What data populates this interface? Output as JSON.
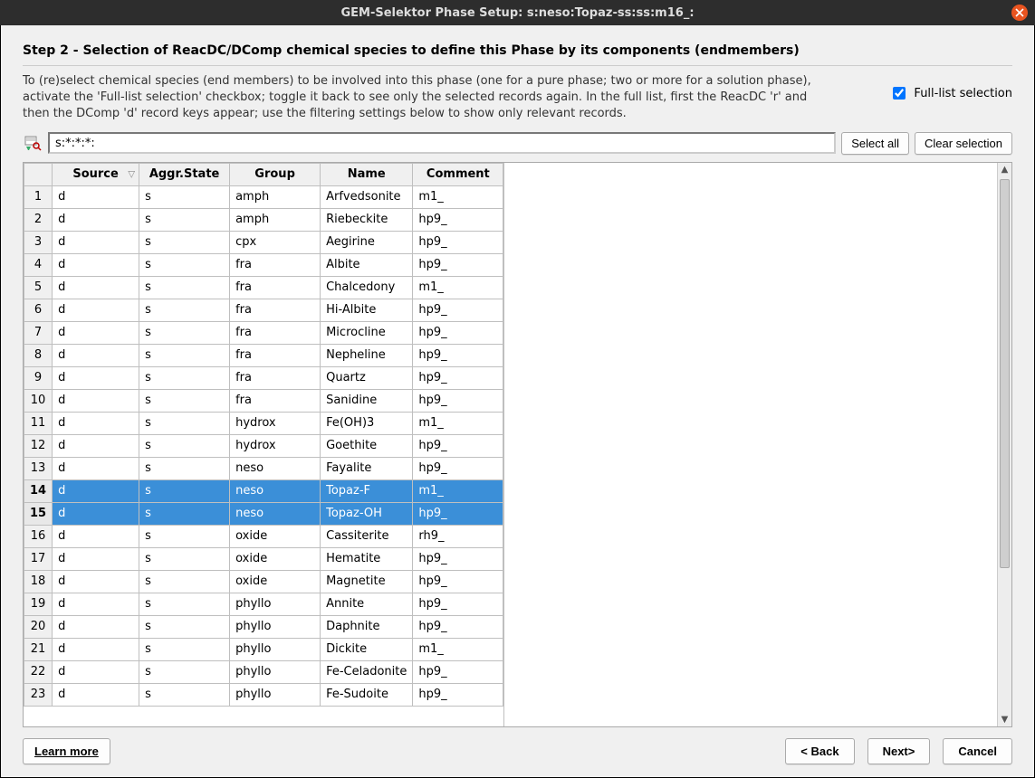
{
  "title": "GEM-Selektor Phase Setup:  s:neso:Topaz-ss:ss:m16_:",
  "step_title": "Step 2 - Selection of ReacDC/DComp chemical species to define this Phase by its components (endmembers)",
  "instructions_l1": "To (re)select chemical species (end members) to be involved into this phase (one for a pure phase; two or more for a solution phase),",
  "instructions_l2": "activate the 'Full-list selection' checkbox; toggle it back to see only the selected records again. In the full list, first the ReacDC 'r' and",
  "instructions_l3": "then the DComp 'd' record keys appear; use the filtering settings below to show only relevant records.",
  "full_list_label": "Full-list selection",
  "full_list_checked": true,
  "filter_value": "s:*:*:*:",
  "select_all_label": "Select all",
  "clear_selection_label": "Clear selection",
  "columns": {
    "source": "Source",
    "aggr": "Aggr.State",
    "group": "Group",
    "name": "Name",
    "comment": "Comment"
  },
  "rows": [
    {
      "n": "1",
      "source": "d",
      "aggr": "s",
      "group": "amph",
      "name": "Arfvedsonite",
      "comment": "m1_",
      "selected": false
    },
    {
      "n": "2",
      "source": "d",
      "aggr": "s",
      "group": "amph",
      "name": "Riebeckite",
      "comment": "hp9_",
      "selected": false
    },
    {
      "n": "3",
      "source": "d",
      "aggr": "s",
      "group": "cpx",
      "name": "Aegirine",
      "comment": "hp9_",
      "selected": false
    },
    {
      "n": "4",
      "source": "d",
      "aggr": "s",
      "group": "fra",
      "name": "Albite",
      "comment": "hp9_",
      "selected": false
    },
    {
      "n": "5",
      "source": "d",
      "aggr": "s",
      "group": "fra",
      "name": "Chalcedony",
      "comment": "m1_",
      "selected": false
    },
    {
      "n": "6",
      "source": "d",
      "aggr": "s",
      "group": "fra",
      "name": "Hi-Albite",
      "comment": "hp9_",
      "selected": false
    },
    {
      "n": "7",
      "source": "d",
      "aggr": "s",
      "group": "fra",
      "name": "Microcline",
      "comment": "hp9_",
      "selected": false
    },
    {
      "n": "8",
      "source": "d",
      "aggr": "s",
      "group": "fra",
      "name": "Nepheline",
      "comment": "hp9_",
      "selected": false
    },
    {
      "n": "9",
      "source": "d",
      "aggr": "s",
      "group": "fra",
      "name": "Quartz",
      "comment": "hp9_",
      "selected": false
    },
    {
      "n": "10",
      "source": "d",
      "aggr": "s",
      "group": "fra",
      "name": "Sanidine",
      "comment": "hp9_",
      "selected": false
    },
    {
      "n": "11",
      "source": "d",
      "aggr": "s",
      "group": "hydrox",
      "name": "Fe(OH)3",
      "comment": "m1_",
      "selected": false
    },
    {
      "n": "12",
      "source": "d",
      "aggr": "s",
      "group": "hydrox",
      "name": "Goethite",
      "comment": "hp9_",
      "selected": false
    },
    {
      "n": "13",
      "source": "d",
      "aggr": "s",
      "group": "neso",
      "name": "Fayalite",
      "comment": "hp9_",
      "selected": false
    },
    {
      "n": "14",
      "source": "d",
      "aggr": "s",
      "group": "neso",
      "name": "Topaz-F",
      "comment": "m1_",
      "selected": true
    },
    {
      "n": "15",
      "source": "d",
      "aggr": "s",
      "group": "neso",
      "name": "Topaz-OH",
      "comment": "hp9_",
      "selected": true
    },
    {
      "n": "16",
      "source": "d",
      "aggr": "s",
      "group": "oxide",
      "name": "Cassiterite",
      "comment": "rh9_",
      "selected": false
    },
    {
      "n": "17",
      "source": "d",
      "aggr": "s",
      "group": "oxide",
      "name": "Hematite",
      "comment": "hp9_",
      "selected": false
    },
    {
      "n": "18",
      "source": "d",
      "aggr": "s",
      "group": "oxide",
      "name": "Magnetite",
      "comment": "hp9_",
      "selected": false
    },
    {
      "n": "19",
      "source": "d",
      "aggr": "s",
      "group": "phyllo",
      "name": "Annite",
      "comment": "hp9_",
      "selected": false
    },
    {
      "n": "20",
      "source": "d",
      "aggr": "s",
      "group": "phyllo",
      "name": "Daphnite",
      "comment": "hp9_",
      "selected": false
    },
    {
      "n": "21",
      "source": "d",
      "aggr": "s",
      "group": "phyllo",
      "name": "Dickite",
      "comment": "m1_",
      "selected": false
    },
    {
      "n": "22",
      "source": "d",
      "aggr": "s",
      "group": "phyllo",
      "name": "Fe-Celadonite",
      "comment": "hp9_",
      "selected": false
    },
    {
      "n": "23",
      "source": "d",
      "aggr": "s",
      "group": "phyllo",
      "name": "Fe-Sudoite",
      "comment": "hp9_",
      "selected": false
    }
  ],
  "footer": {
    "learn_more": "Learn more",
    "back": "< Back",
    "next": "Next>",
    "cancel": "Cancel"
  }
}
